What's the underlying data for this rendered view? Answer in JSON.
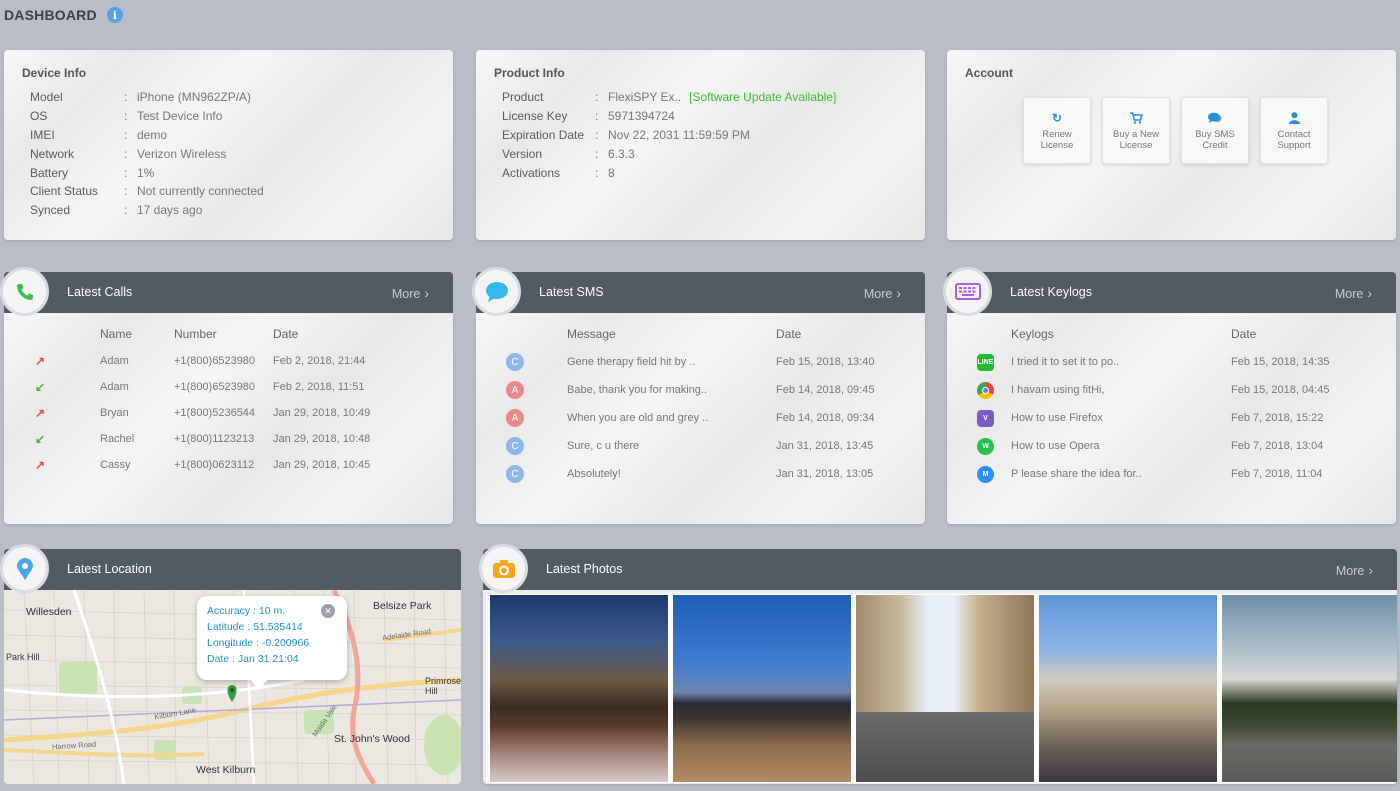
{
  "header": {
    "title": "DASHBOARD",
    "info_glyph": "i"
  },
  "device_info": {
    "title": "Device Info",
    "rows": [
      {
        "key": "Model",
        "value": "iPhone (MN962ZP/A)"
      },
      {
        "key": "OS",
        "value": "Test Device Info"
      },
      {
        "key": "IMEI",
        "value": "demo"
      },
      {
        "key": "Network",
        "value": "Verizon Wireless"
      },
      {
        "key": "Battery",
        "value": "1%"
      },
      {
        "key": "Client Status",
        "value": "Not currently connected"
      },
      {
        "key": "Synced",
        "value": "17 days ago"
      }
    ]
  },
  "product_info": {
    "title": "Product Info",
    "rows": [
      {
        "key": "Product",
        "value": "FlexiSPY Ex..",
        "alert": "[Software Update Available]"
      },
      {
        "key": "License Key",
        "value": "5971394724"
      },
      {
        "key": "Expiration Date",
        "value": "Nov 22, 2031 11:59:59 PM"
      },
      {
        "key": "Version",
        "value": "6.3.3"
      },
      {
        "key": "Activations",
        "value": "8"
      }
    ]
  },
  "account": {
    "title": "Account",
    "buttons": [
      {
        "icon": "refresh-icon",
        "line1": "Renew",
        "line2": "License"
      },
      {
        "icon": "cart-icon",
        "line1": "Buy a New",
        "line2": "License"
      },
      {
        "icon": "chat-icon",
        "line1": "Buy SMS",
        "line2": "Credit"
      },
      {
        "icon": "user-icon",
        "line1": "Contact",
        "line2": "Support"
      }
    ]
  },
  "calls": {
    "title": "Latest Calls",
    "more": "More",
    "headers": {
      "name": "Name",
      "number": "Number",
      "date": "Date"
    },
    "rows": [
      {
        "dir": "outgoing",
        "name": "Adam",
        "number": "+1(800)6523980",
        "date": "Feb 2, 2018, 21:44"
      },
      {
        "dir": "incoming",
        "name": "Adam",
        "number": "+1(800)6523980",
        "date": "Feb 2, 2018, 11:51"
      },
      {
        "dir": "outgoing",
        "name": "Bryan",
        "number": "+1(800)5236544",
        "date": "Jan 29, 2018, 10:49"
      },
      {
        "dir": "incoming",
        "name": "Rachel",
        "number": "+1(800)1123213",
        "date": "Jan 29, 2018, 10:48"
      },
      {
        "dir": "outgoing",
        "name": "Cassy",
        "number": "+1(800)0623112",
        "date": "Jan 29, 2018, 10:45"
      }
    ]
  },
  "sms": {
    "title": "Latest SMS",
    "more": "More",
    "headers": {
      "message": "Message",
      "date": "Date"
    },
    "rows": [
      {
        "avatar": "C",
        "color": "#8fb6e6",
        "message": "Gene therapy field hit by ..",
        "date": "Feb 15, 2018, 13:40"
      },
      {
        "avatar": "A",
        "color": "#e98989",
        "message": "Babe, thank you for making..",
        "date": "Feb 14, 2018, 09:45"
      },
      {
        "avatar": "A",
        "color": "#e98989",
        "message": "When you are old and grey ..",
        "date": "Feb 14, 2018, 09:34"
      },
      {
        "avatar": "C",
        "color": "#8fb6e6",
        "message": "Sure, c u there",
        "date": "Jan 31, 2018, 13:45"
      },
      {
        "avatar": "C",
        "color": "#8fb6e6",
        "message": "Absolutely!",
        "date": "Jan 31, 2018, 13:05"
      }
    ]
  },
  "keylogs": {
    "title": "Latest Keylogs",
    "more": "More",
    "headers": {
      "keylogs": "Keylogs",
      "date": "Date"
    },
    "rows": [
      {
        "app": "line-icon",
        "glyph": "LINE",
        "color": "#1fbd2d",
        "text": "I tried it to set it to po..",
        "date": "Feb 15, 2018, 14:35"
      },
      {
        "app": "chrome-icon",
        "glyph": "",
        "color": "#e8453c",
        "text": "I havam using fitHi,",
        "date": "Feb 15, 2018, 04:45"
      },
      {
        "app": "viber-icon",
        "glyph": "V",
        "color": "#7b5cc6",
        "text": "How to use Firefox",
        "date": "Feb 7, 2018, 15:22"
      },
      {
        "app": "whatsapp-icon",
        "glyph": "W",
        "color": "#25c04d",
        "text": "How to use Opera",
        "date": "Feb 7, 2018, 13:04"
      },
      {
        "app": "messenger-icon",
        "glyph": "M",
        "color": "#2d8ef5",
        "text": "P lease share the idea for..",
        "date": "Feb 7, 2018, 11:04"
      }
    ]
  },
  "location": {
    "title": "Latest Location",
    "popup": {
      "accuracy": "Accuracy : 10 m.",
      "latitude": "Latitude : 51.535414",
      "longitude": "Longitude : -0.200966",
      "date": "Date : Jan 31 21:04"
    },
    "labels": {
      "willesden": "Willesden",
      "belsize": "Belsize Park",
      "park_hill": "Park Hill",
      "primrose": "Primrose Hill",
      "st_johns": "St. John's Wood",
      "west_kilburn": "West Kilburn",
      "kilburn_lane": "Kilburn Lane",
      "harrow_road": "Harrow Road",
      "adelaide": "Adelaide Road",
      "maida_vale": "Maida Vale"
    }
  },
  "photos": {
    "title": "Latest Photos",
    "more": "More",
    "items": [
      "night-river-photo",
      "evening-street-photo",
      "town-street-photo",
      "terrace-houses-photo",
      "park-sunset-photo"
    ]
  }
}
